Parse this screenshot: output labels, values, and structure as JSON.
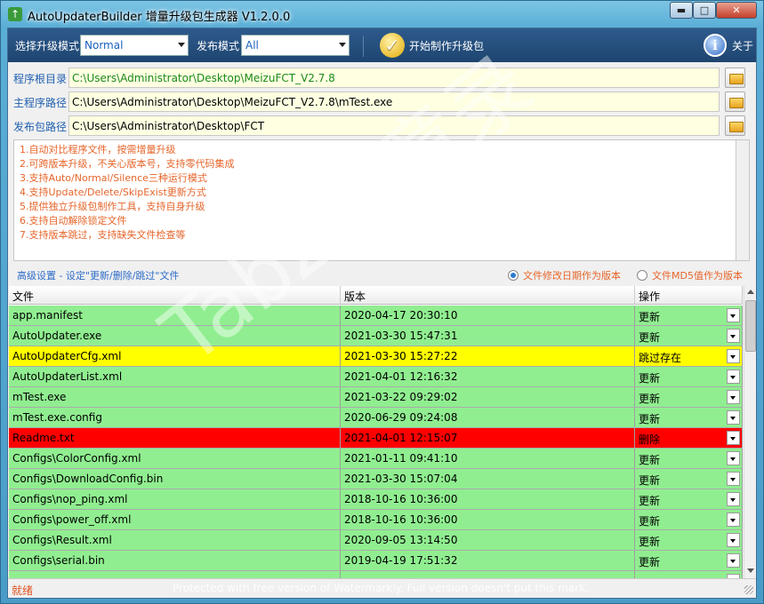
{
  "window": {
    "title": "AutoUpdaterBuilder 增量升级包生成器 V1.2.0.0",
    "minimize": "▬",
    "maximize": "□",
    "close": "✕"
  },
  "toolbar": {
    "mode_label": "选择升级模式",
    "mode_value": "Normal",
    "publish_label": "发布模式",
    "publish_value": "All",
    "start_label": "开始制作升级包",
    "about_label": "关于"
  },
  "paths": [
    {
      "label": "程序根目录",
      "value": "C:\\Users\\Administrator\\Desktop\\MeizuFCT_V2.7.8"
    },
    {
      "label": "主程序路径",
      "value": "C:\\Users\\Administrator\\Desktop\\MeizuFCT_V2.7.8\\mTest.exe"
    },
    {
      "label": "发布包路径",
      "value": "C:\\Users\\Administrator\\Desktop\\FCT"
    }
  ],
  "description": [
    "1.自动对比程序文件，按需增量升级",
    "2.可跨版本升级，不关心版本号，支持零代码集成",
    "3.支持Auto/Normal/Silence三种运行模式",
    "4.支持Update/Delete/SkipExist更新方式",
    "5.提供独立升级包制作工具，支持自身升级",
    "6.支持自动解除锁定文件",
    "7.支持版本跳过，支持缺失文件检查等"
  ],
  "advanced_link": "高级设置 - 设定\"更新/删除/跳过\"文件",
  "radio_date": "文件修改日期作为版本",
  "radio_md5": "文件MD5值作为版本",
  "grid": {
    "headers": [
      "文件",
      "版本",
      "操作"
    ],
    "rows": [
      {
        "file": "app.manifest",
        "version": "2020-04-17 20:30:10",
        "op": "更新",
        "color": "#90ee90"
      },
      {
        "file": "AutoUpdater.exe",
        "version": "2021-03-30 15:47:31",
        "op": "更新",
        "color": "#90ee90"
      },
      {
        "file": "AutoUpdaterCfg.xml",
        "version": "2021-03-30 15:27:22",
        "op": "跳过存在",
        "color": "#ffff00"
      },
      {
        "file": "AutoUpdaterList.xml",
        "version": "2021-04-01 12:16:32",
        "op": "更新",
        "color": "#90ee90"
      },
      {
        "file": "mTest.exe",
        "version": "2021-03-22 09:29:02",
        "op": "更新",
        "color": "#90ee90"
      },
      {
        "file": "mTest.exe.config",
        "version": "2020-06-29 09:24:08",
        "op": "更新",
        "color": "#90ee90"
      },
      {
        "file": "Readme.txt",
        "version": "2021-04-01 12:15:07",
        "op": "删除",
        "color": "#ff0000"
      },
      {
        "file": "Configs\\ColorConfig.xml",
        "version": "2021-01-11 09:41:10",
        "op": "更新",
        "color": "#90ee90"
      },
      {
        "file": "Configs\\DownloadConfig.bin",
        "version": "2021-03-30 15:07:04",
        "op": "更新",
        "color": "#90ee90"
      },
      {
        "file": "Configs\\nop_ping.xml",
        "version": "2018-10-16 10:36:00",
        "op": "更新",
        "color": "#90ee90"
      },
      {
        "file": "Configs\\power_off.xml",
        "version": "2018-10-16 10:36:00",
        "op": "更新",
        "color": "#90ee90"
      },
      {
        "file": "Configs\\Result.xml",
        "version": "2020-09-05 13:14:50",
        "op": "更新",
        "color": "#90ee90"
      },
      {
        "file": "Configs\\serial.bin",
        "version": "2019-04-19 17:51:32",
        "op": "更新",
        "color": "#90ee90"
      },
      {
        "file": "",
        "version": "",
        "op": "",
        "color": "#90ee90"
      }
    ]
  },
  "status": "就绪",
  "footer_watermark": "Protected with free version of Watermarkly. Full version doesn't put this mark.",
  "overlay_watermark": "TabZ随意录"
}
